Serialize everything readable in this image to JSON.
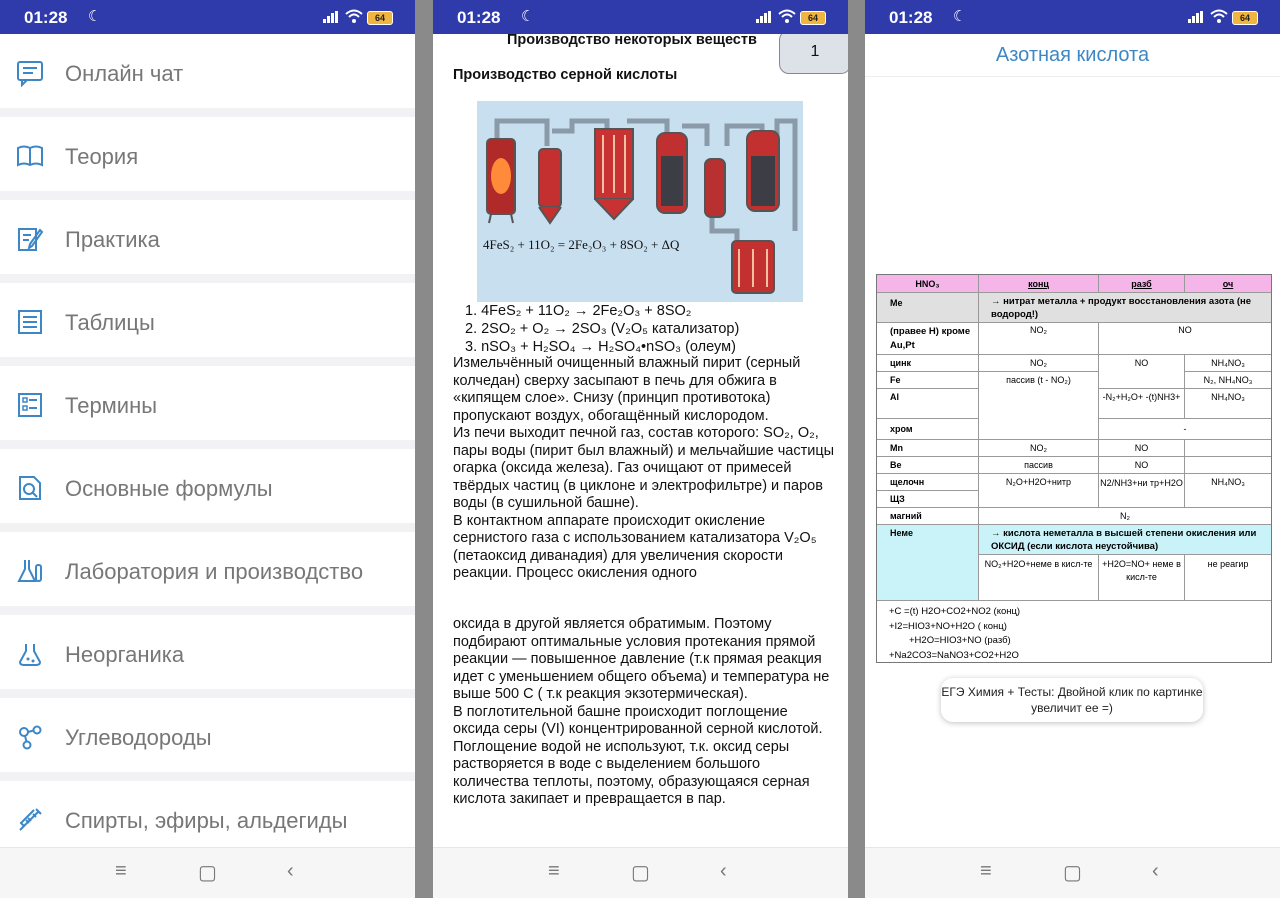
{
  "status": {
    "time": "01:28",
    "battery": "64"
  },
  "menu": {
    "items": [
      {
        "label": "Онлайн чат"
      },
      {
        "label": "Теория"
      },
      {
        "label": "Практика"
      },
      {
        "label": "Таблицы"
      },
      {
        "label": "Термины"
      },
      {
        "label": "Основные формулы"
      },
      {
        "label": "Лаборатория и производство"
      },
      {
        "label": "Неорганика"
      },
      {
        "label": "Углеводороды"
      },
      {
        "label": "Спирты, эфиры, альдегиды"
      }
    ]
  },
  "doc": {
    "title": "Производство некоторых веществ",
    "page": "1",
    "subtitle": "Производство серной кислоты",
    "diagram_formula": "4FeS₂ + 11O₂ = 2Fe₂O₃ + 8SO₂ + ΔQ",
    "reactions": [
      "1.   4FeS₂ + 11O₂ → 2Fe₂O₃ + 8SO₂",
      "2.   2SO₂ + O₂ → 2SO₃ (V₂O₅ катализатор)",
      "3.   nSO₃ + H₂SO₄ → H₂SO₄•nSO₃ (олеум)"
    ],
    "para1": "Измельчённый очищенный влажный пирит (серный колчедан) сверху засыпают в печь для обжига в «кипящем слое». Снизу (принцип противотока) пропускают воздух, обогащённый кислородом.\nИз печи выходит печной газ, состав которого: SO₂, O₂, пары воды (пирит был влажный) и мельчайшие частицы огарка (оксида железа). Газ очищают от примесей твёрдых частиц (в циклоне и электрофильтре) и паров воды (в сушильной башне).\nВ контактном аппарате происходит окисление сернистого газа с использованием катализатора V₂O₅ (петаоксид диванадия) для увеличения скорости реакции. Процесс окисления одного",
    "para2": "оксида в другой является обратимым. Поэтому подбирают оптимальные условия протекания прямой реакции — повышенное давление (т.к прямая реакция идет с уменьшением общего объема) и температура не выше 500 С ( т.к реакция экзотермическая).\nВ поглотительной башне происходит поглощение оксида серы (VI) концентрированной серной кислотой.\nПоглощение водой не используют, т.к. оксид серы растворяется в воде с выделением большого количества теплоты, поэтому, образующаяся серная кислота закипает и превращается в пар."
  },
  "article": {
    "title": "Азотная кислота",
    "table": {
      "h_hno3": "HNO₃",
      "h_konc": "конц",
      "h_razb": "разб",
      "h_och": "оч",
      "me": "Me",
      "me_note": "→ нитрат металла + продукт восстановления азота (не водород!)",
      "right_h": "(правее Н) кроме Au,Pt",
      "right_h_konc": "NO₂",
      "right_h_razb": "NO",
      "zinc": "цинк",
      "zinc_konc": "NO₂",
      "zinc_razb": "NO",
      "zinc_och": "NH₄NO₃",
      "fe": "Fe",
      "fe_konc": "пассив (t - NO₂)",
      "fe_och": "N₂, NH₄NO₃",
      "al": "Al",
      "al_razb": "-N₂+H₂O+ -(t)NH3+",
      "al_och": "NH₄NO₃",
      "chrom": "хром",
      "chrom_och": "-",
      "mn": "Mn",
      "mn_konc": "NO₂",
      "mn_razb": "NO",
      "be": "Be",
      "be_konc": "пассив",
      "be_razb": "NO",
      "alkali": "щелочн",
      "alkali_earth": "ЩЗ",
      "alkali_konc": "N₂O+H2O+нитр",
      "alkali_razb": "N2/NH3+ни тр+H2O",
      "alkali_och": "NH₄NO₃",
      "magnesium": "магний",
      "magnesium_val": "N₂",
      "nonme": "Неме",
      "nonme_note": "→ кислота неметалла в высшей степени окисления или ОКСИД (если кислота неустойчива)",
      "nonme_konc": "NO₂+H2O+неме в кисл-те",
      "nonme_razb": "+H2O=NO+ неме в кисл-те",
      "nonme_och": "не реагир",
      "ex1": "+C =(t) H2O+CO2+NO2 (конц)",
      "ex2": "+I2=HIO3+NO+H2O ( конц)",
      "ex3": "+H2O=HIO3+NO (разб)",
      "ex4": "+Na2CO3=NaNO3+CO2+H2O"
    },
    "toast": "ЕГЭ Химия + Тесты: Двойной клик по картинке увеличит ее =)"
  },
  "colors": {
    "statusbar": "#2f3baa",
    "title": "#3d87c6",
    "pink": "#f5b5e8",
    "cyan": "#c9f3f8",
    "menu_text": "#777777"
  }
}
